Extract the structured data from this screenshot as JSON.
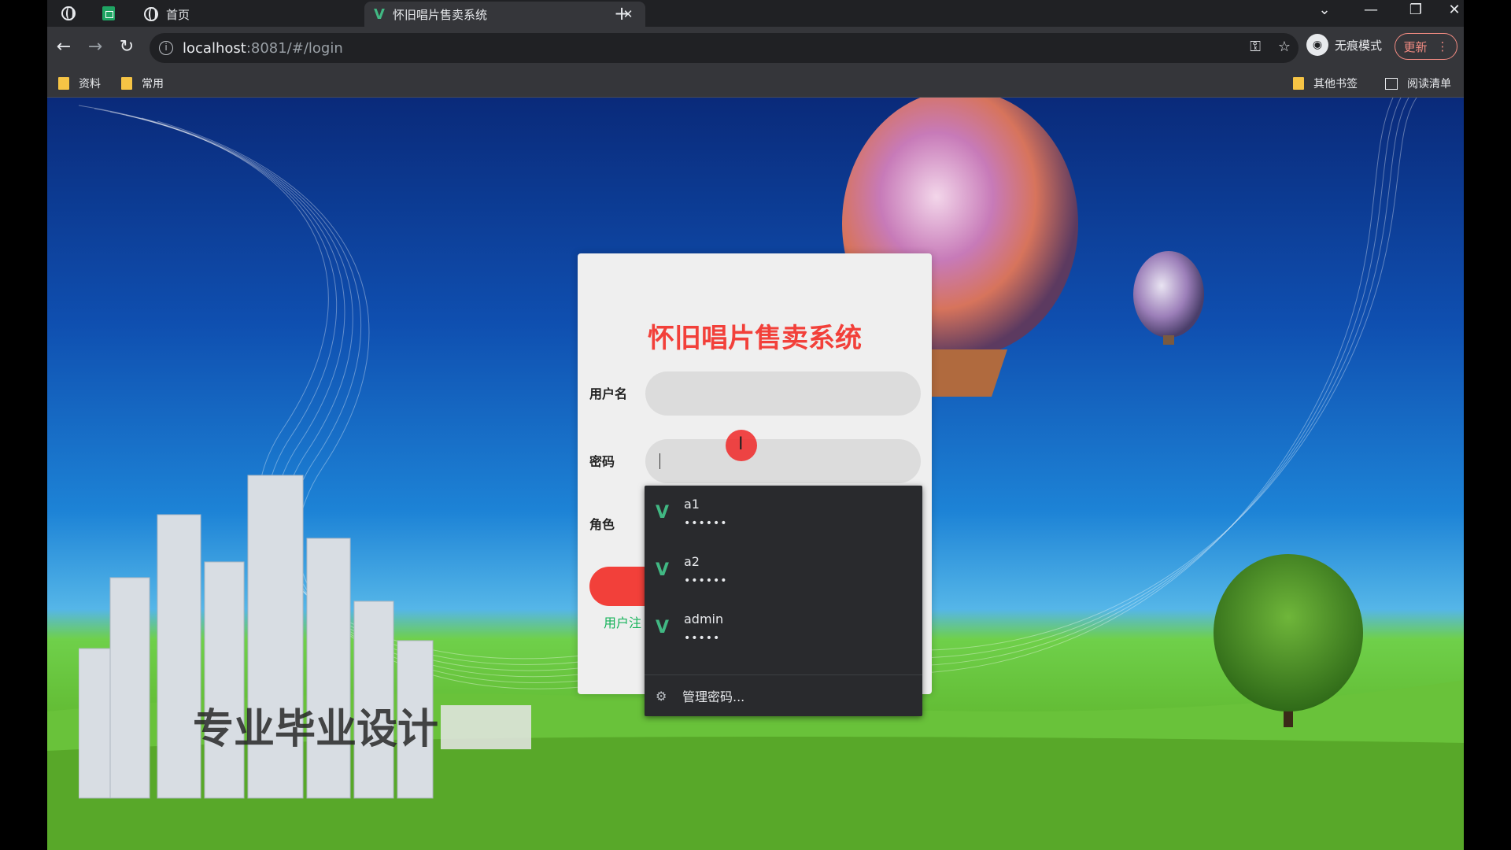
{
  "tabs": [
    {
      "label": "首页",
      "icon": "globe-icon"
    },
    {
      "label": "怀旧唱片售卖系统",
      "icon": "vue-icon"
    }
  ],
  "toolbar": {
    "url_host": "localhost",
    "url_rest": ":8081/#/login",
    "incognito_label": "无痕模式",
    "update_label": "更新"
  },
  "bookmarks": {
    "items": [
      {
        "label": "资料"
      },
      {
        "label": "常用"
      }
    ],
    "other_label": "其他书签",
    "reading_list_label": "阅读清单"
  },
  "login": {
    "title": "怀旧唱片售卖系统",
    "username_label": "用户名",
    "password_label": "密码",
    "role_label": "角色",
    "register_link": "用户注"
  },
  "autofill": {
    "entries": [
      {
        "username": "a1",
        "password": "••••••"
      },
      {
        "username": "a2",
        "password": "••••••"
      },
      {
        "username": "admin",
        "password": "•••••"
      }
    ],
    "manage_label": "管理密码..."
  },
  "watermark": "专业毕业设计",
  "colors": {
    "title_red": "#f2403a",
    "register_green": "#16b35a",
    "vue_green": "#41b883"
  }
}
